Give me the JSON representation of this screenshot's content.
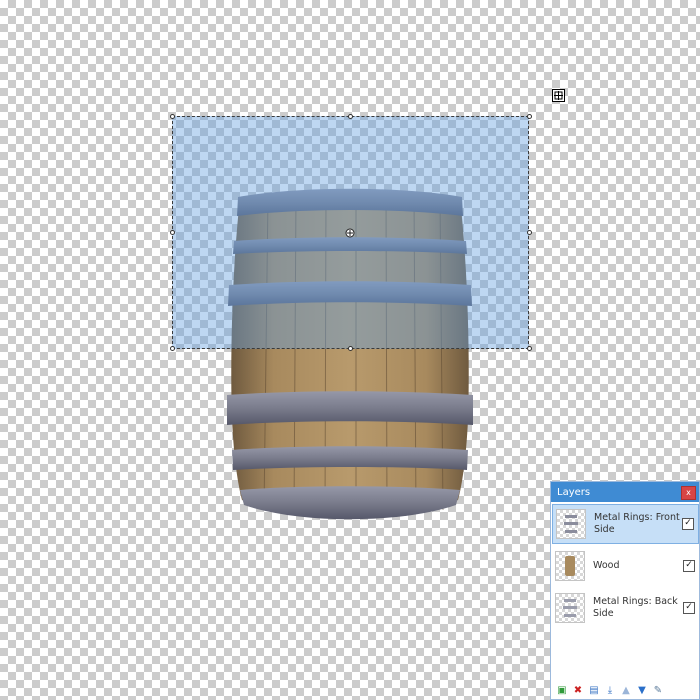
{
  "layers_panel": {
    "title": "Layers",
    "close_label": "x",
    "layers": [
      {
        "name": "Metal Rings: Front Side",
        "visible": true,
        "selected": true
      },
      {
        "name": "Wood",
        "visible": true,
        "selected": false
      },
      {
        "name": "Metal Rings: Back Side",
        "visible": true,
        "selected": false
      }
    ],
    "toolbar_icons": [
      "add-layer-icon",
      "delete-layer-icon",
      "duplicate-layer-icon",
      "merge-layer-down-icon",
      "move-layer-up-icon",
      "move-layer-down-icon",
      "layer-properties-icon"
    ]
  },
  "colors": {
    "selection_fill": "#64a0e1",
    "titlebar": "#3f8bd3",
    "close_button": "#d84545",
    "selected_row": "#c6dff7",
    "wood": "#a88a5e",
    "metal_ring": "#7a7c8c"
  }
}
